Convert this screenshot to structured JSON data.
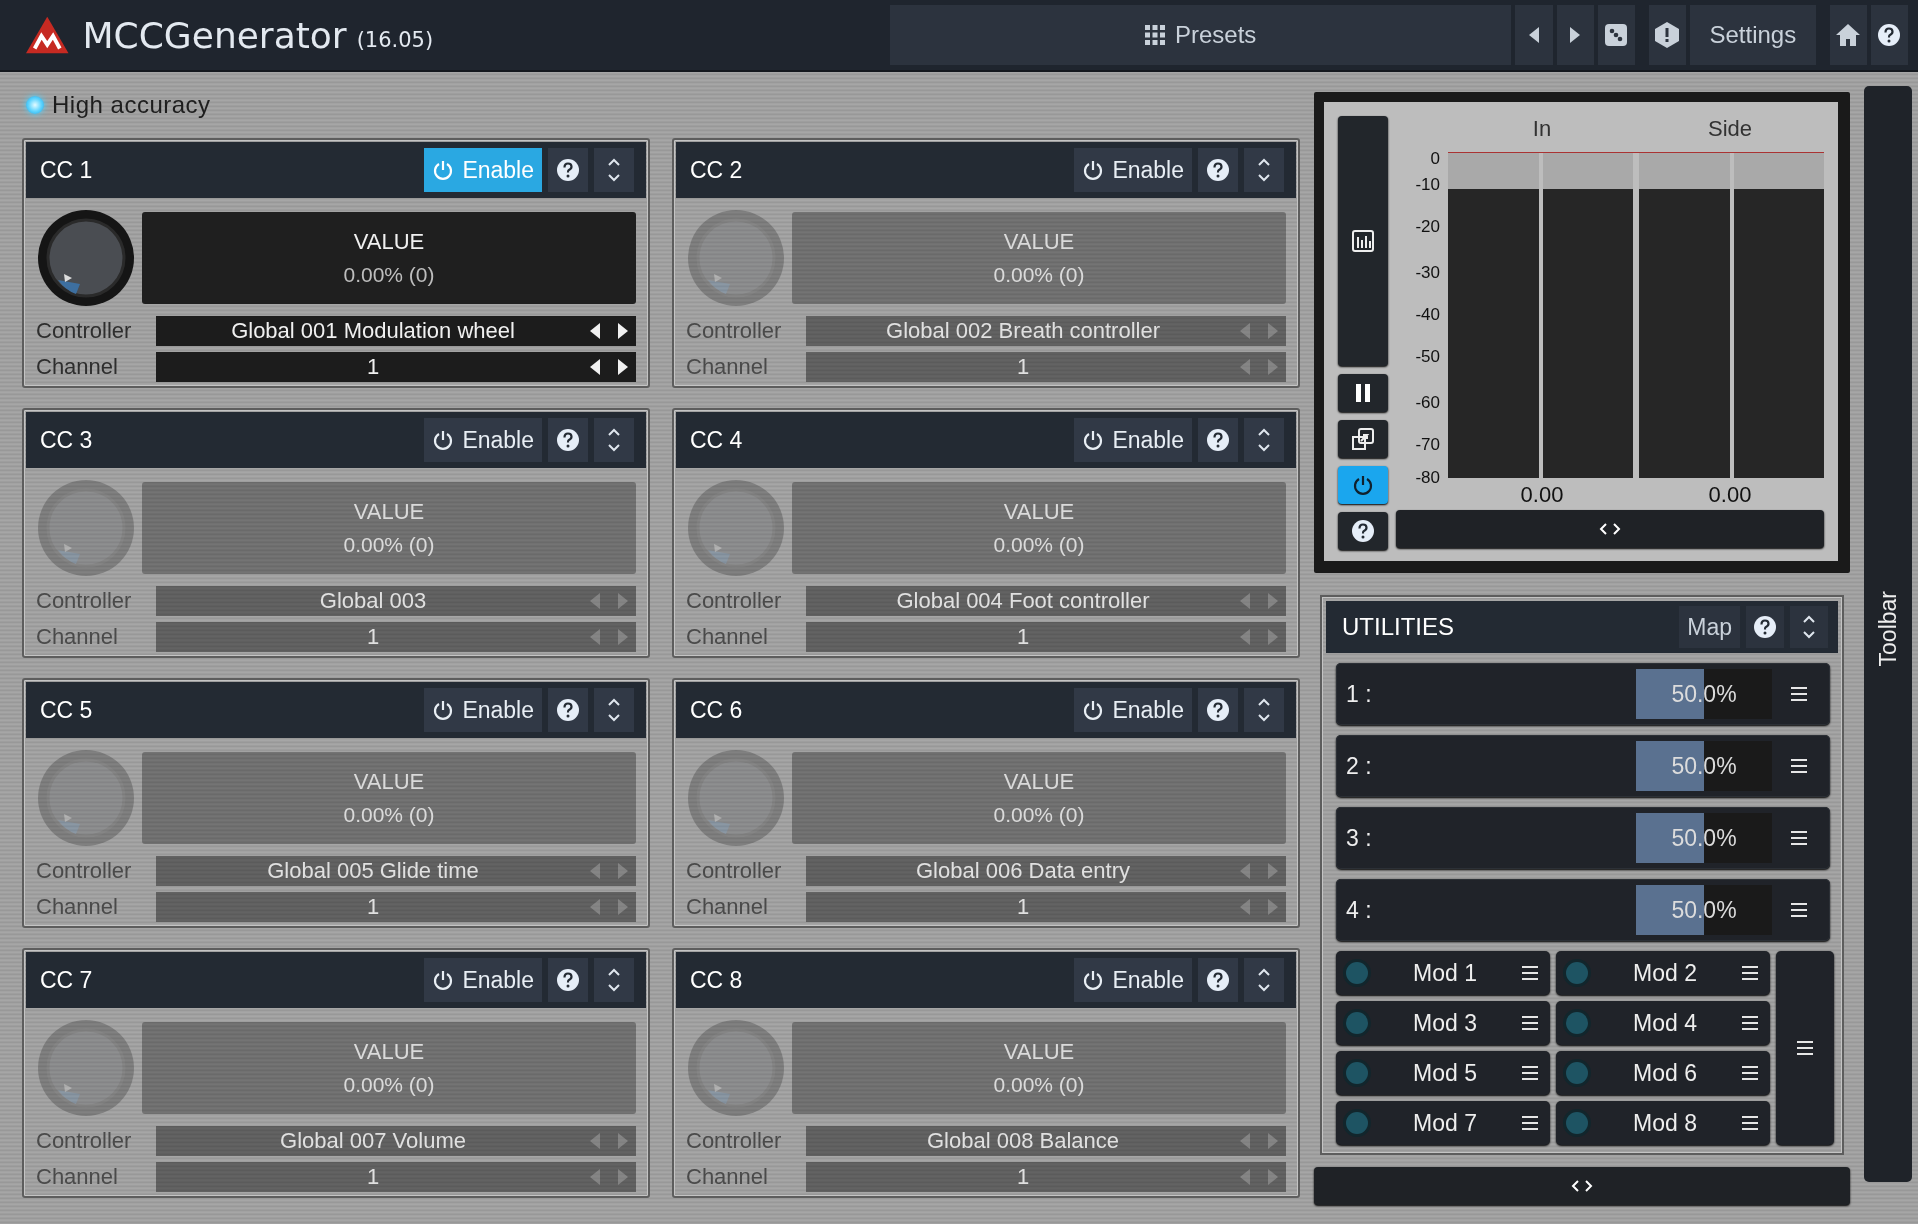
{
  "header": {
    "title": "MCCGenerator",
    "version": "(16.05)",
    "presets": "Presets",
    "settings": "Settings"
  },
  "high_accuracy": {
    "label": "High accuracy",
    "on": true
  },
  "cc_panels": [
    {
      "title": "CC 1",
      "enabled": true,
      "enable_label": "Enable",
      "value_label": "VALUE",
      "value": "0.00% (0)",
      "controller_label": "Controller",
      "controller": "Global 001 Modulation wheel",
      "channel_label": "Channel",
      "channel": "1"
    },
    {
      "title": "CC 2",
      "enabled": false,
      "enable_label": "Enable",
      "value_label": "VALUE",
      "value": "0.00% (0)",
      "controller_label": "Controller",
      "controller": "Global 002 Breath controller",
      "channel_label": "Channel",
      "channel": "1"
    },
    {
      "title": "CC 3",
      "enabled": false,
      "enable_label": "Enable",
      "value_label": "VALUE",
      "value": "0.00% (0)",
      "controller_label": "Controller",
      "controller": "Global 003",
      "channel_label": "Channel",
      "channel": "1"
    },
    {
      "title": "CC 4",
      "enabled": false,
      "enable_label": "Enable",
      "value_label": "VALUE",
      "value": "0.00% (0)",
      "controller_label": "Controller",
      "controller": "Global 004 Foot controller",
      "channel_label": "Channel",
      "channel": "1"
    },
    {
      "title": "CC 5",
      "enabled": false,
      "enable_label": "Enable",
      "value_label": "VALUE",
      "value": "0.00% (0)",
      "controller_label": "Controller",
      "controller": "Global 005 Glide time",
      "channel_label": "Channel",
      "channel": "1"
    },
    {
      "title": "CC 6",
      "enabled": false,
      "enable_label": "Enable",
      "value_label": "VALUE",
      "value": "0.00% (0)",
      "controller_label": "Controller",
      "controller": "Global 006 Data entry",
      "channel_label": "Channel",
      "channel": "1"
    },
    {
      "title": "CC 7",
      "enabled": false,
      "enable_label": "Enable",
      "value_label": "VALUE",
      "value": "0.00% (0)",
      "controller_label": "Controller",
      "controller": "Global 007 Volume",
      "channel_label": "Channel",
      "channel": "1"
    },
    {
      "title": "CC 8",
      "enabled": false,
      "enable_label": "Enable",
      "value_label": "VALUE",
      "value": "0.00% (0)",
      "controller_label": "Controller",
      "controller": "Global 008 Balance",
      "channel_label": "Channel",
      "channel": "1"
    }
  ],
  "meter": {
    "columns": [
      "In",
      "Side"
    ],
    "scale": [
      "0",
      "-10",
      "-20",
      "-30",
      "-40",
      "-50",
      "-60",
      "-70",
      "-80"
    ],
    "readings": [
      "0.00",
      "0.00"
    ],
    "power_on": true
  },
  "utilities": {
    "title": "UTILITIES",
    "map": "Map",
    "sliders": [
      {
        "label": "1 :",
        "value": "50.0%",
        "level": 0.5
      },
      {
        "label": "2 :",
        "value": "50.0%",
        "level": 0.5
      },
      {
        "label": "3 :",
        "value": "50.0%",
        "level": 0.5
      },
      {
        "label": "4 :",
        "value": "50.0%",
        "level": 0.5
      }
    ],
    "mods": [
      {
        "label": "Mod 1"
      },
      {
        "label": "Mod 2"
      },
      {
        "label": "Mod 3"
      },
      {
        "label": "Mod 4"
      },
      {
        "label": "Mod 5"
      },
      {
        "label": "Mod 6"
      },
      {
        "label": "Mod 7"
      },
      {
        "label": "Mod 8"
      }
    ]
  },
  "toolbar": {
    "label": "Toolbar"
  }
}
